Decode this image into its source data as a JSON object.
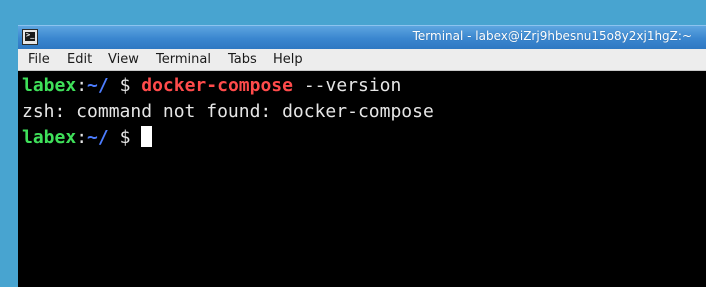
{
  "window": {
    "title": "Terminal - labex@iZrj9hbesnu15o8y2xj1hgZ:~",
    "icon": "terminal-icon"
  },
  "menubar": {
    "items": [
      "File",
      "Edit",
      "View",
      "Terminal",
      "Tabs",
      "Help"
    ]
  },
  "terminal": {
    "colors": {
      "background": "#000000",
      "user": "#3fe05a",
      "path": "#4d7dff",
      "command": "#ff4b4b",
      "text": "#e6e6e6"
    },
    "lines": [
      {
        "type": "prompt",
        "user": "labex",
        "sep": ":",
        "path": "~/",
        "symbol": "$",
        "command": "docker-compose",
        "args": "--version"
      },
      {
        "type": "output",
        "text": "zsh: command not found: docker-compose"
      },
      {
        "type": "prompt",
        "user": "labex",
        "sep": ":",
        "path": "~/",
        "symbol": "$",
        "command": "",
        "args": ""
      }
    ]
  }
}
